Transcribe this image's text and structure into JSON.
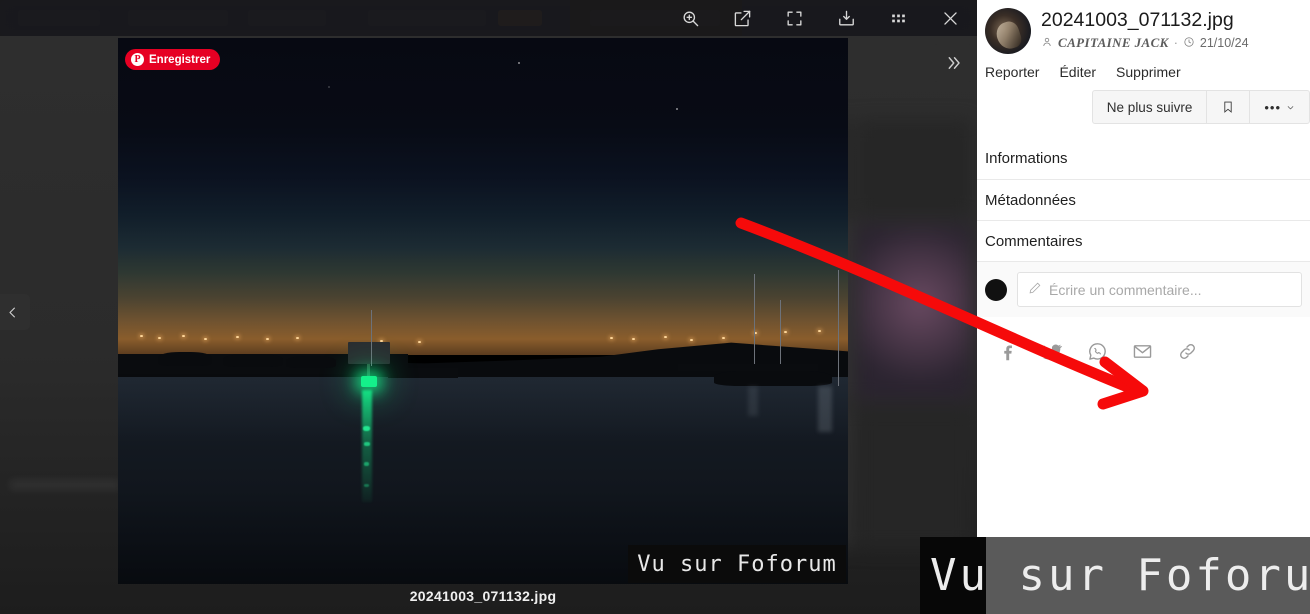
{
  "backdrop": {
    "description": "blurred forum page behind modal"
  },
  "toolbar": {
    "buttons": [
      {
        "name": "zoom-in-icon",
        "label": "Zoom avant"
      },
      {
        "name": "external-link-icon",
        "label": "Ouvrir dans un nouvel onglet"
      },
      {
        "name": "fullscreen-icon",
        "label": "Plein écran"
      },
      {
        "name": "download-icon",
        "label": "Télécharger"
      },
      {
        "name": "grid-icon",
        "label": "Galerie"
      },
      {
        "name": "close-icon",
        "label": "Fermer"
      }
    ]
  },
  "viewer": {
    "pin_save_label": "Enregistrer",
    "pin_glyph": "P",
    "watermark": "Vu sur Foforum",
    "caption": "20241003_071132.jpg",
    "prev_label": "Précédent",
    "sidebar_toggle_label": "Réduire le panneau"
  },
  "sidebar": {
    "title": "20241003_071132.jpg",
    "author": "CAPITAINE JACK",
    "separator": "·",
    "date": "21/10/24",
    "actions": [
      {
        "label": "Reporter"
      },
      {
        "label": "Éditer"
      },
      {
        "label": "Supprimer"
      }
    ],
    "buttons": {
      "follow_label": "Ne plus suivre",
      "bookmark_icon": "bookmark-icon",
      "more_label": "•••"
    },
    "sections": [
      {
        "label": "Informations"
      },
      {
        "label": "Métadonnées"
      },
      {
        "label": "Commentaires"
      }
    ],
    "comment": {
      "placeholder": "Écrire un commentaire..."
    },
    "share": [
      {
        "name": "facebook-icon",
        "label": "Facebook"
      },
      {
        "name": "twitter-icon",
        "label": "Twitter"
      },
      {
        "name": "whatsapp-icon",
        "label": "WhatsApp"
      },
      {
        "name": "email-icon",
        "label": "E-mail"
      },
      {
        "name": "link-icon",
        "label": "Copier le lien"
      }
    ]
  },
  "magnifier": {
    "text": "Vu sur Foforum"
  },
  "colors": {
    "pinterest_red": "#e60023",
    "annotation_red": "#f60a0a",
    "toolbar_bg": "#18181b",
    "sidebar_bg": "#ffffff",
    "nav_light_green": "#14f08a"
  }
}
